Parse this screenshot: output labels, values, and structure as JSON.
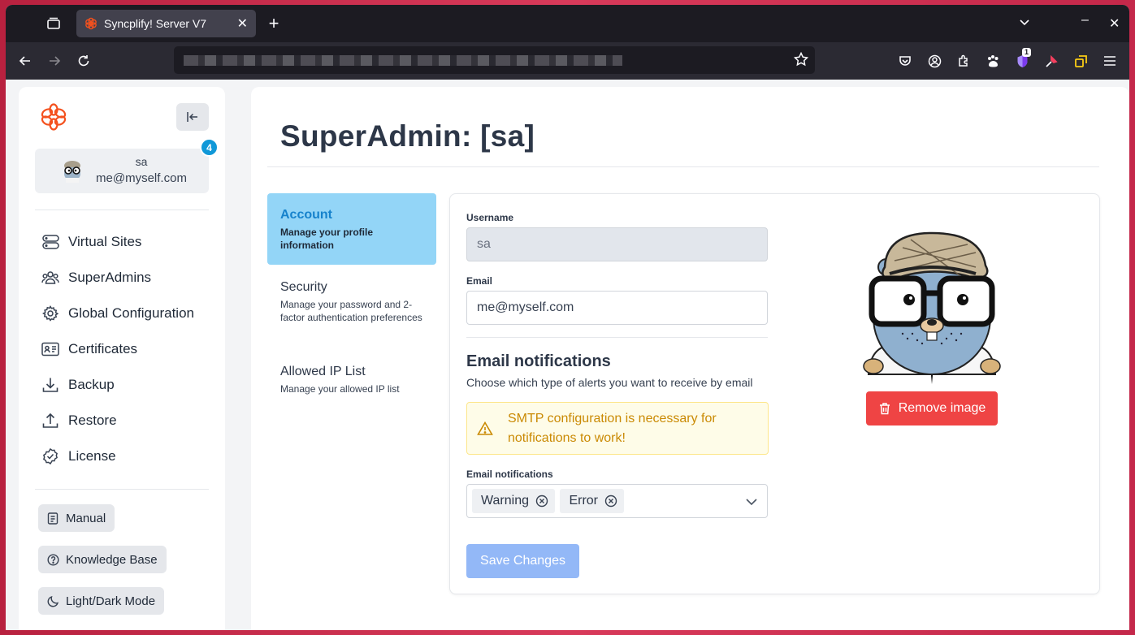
{
  "browser": {
    "tab_title": "Syncplify! Server V7",
    "extension_badge": "1"
  },
  "sidebar": {
    "user": {
      "name": "sa",
      "email": "me@myself.com"
    },
    "badge_count": "4",
    "nav": [
      {
        "label": "Virtual Sites",
        "icon": "server-icon"
      },
      {
        "label": "SuperAdmins",
        "icon": "users-icon"
      },
      {
        "label": "Global Configuration",
        "icon": "gear-icon"
      },
      {
        "label": "Certificates",
        "icon": "id-card-icon"
      },
      {
        "label": "Backup",
        "icon": "download-icon"
      },
      {
        "label": "Restore",
        "icon": "upload-icon"
      },
      {
        "label": "License",
        "icon": "check-badge-icon"
      }
    ],
    "links": [
      {
        "label": "Manual",
        "icon": "book-icon"
      },
      {
        "label": "Knowledge Base",
        "icon": "question-circle-icon"
      },
      {
        "label": "Light/Dark Mode",
        "icon": "moon-icon"
      }
    ]
  },
  "main": {
    "title": "SuperAdmin: [sa]",
    "tabs": [
      {
        "title": "Account",
        "desc": "Manage your profile information",
        "active": true
      },
      {
        "title": "Security",
        "desc": "Manage your password and 2-factor authentication preferences",
        "active": false
      },
      {
        "title": "Allowed IP List",
        "desc": "Manage your allowed IP list",
        "active": false
      }
    ],
    "form": {
      "username_label": "Username",
      "username_value": "sa",
      "email_label": "Email",
      "email_value": "me@myself.com",
      "notifications_title": "Email notifications",
      "notifications_desc": "Choose which type of alerts you want to receive by email",
      "warning": "SMTP configuration is necessary for notifications to work!",
      "select_label": "Email notifications",
      "selected": [
        "Warning",
        "Error"
      ],
      "save_label": "Save Changes",
      "remove_image_label": "Remove image"
    }
  },
  "colors": {
    "accent": "#1682cc",
    "active_tab_bg": "#93d5f7",
    "danger": "#ef4444",
    "warning_text": "#ca8a04",
    "logo": "#f4511e"
  }
}
